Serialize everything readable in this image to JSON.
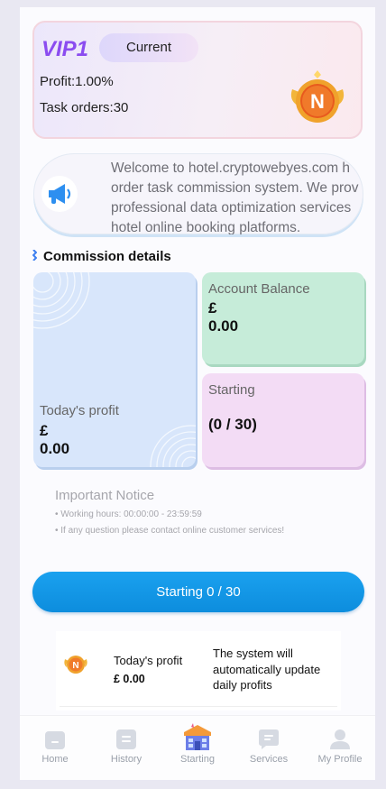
{
  "vip": {
    "level": "VIP1",
    "current_label": "Current",
    "profit": "Profit:1.00%",
    "task_orders": "Task orders:30"
  },
  "announcement": {
    "text": "Welcome to hotel.cryptowebyes.com h order task commission system. We prov professional data optimization services hotel online booking platforms."
  },
  "commission": {
    "title": "Commission details",
    "today_profit_label": "Today's profit",
    "today_profit_currency": "£",
    "today_profit_value": "0.00",
    "balance_label": "Account Balance",
    "balance_currency": "£",
    "balance_value": "0.00",
    "starting_label": "Starting",
    "starting_value": "(0 / 30)"
  },
  "notice": {
    "title": "Important Notice",
    "lines": [
      "• Working hours: 00:00:00 - 23:59:59",
      "• If any question please contact online customer services!"
    ]
  },
  "start_button": {
    "label": "Starting 0 / 30"
  },
  "daily": {
    "label": "Today's profit",
    "value": "£ 0.00",
    "note": "The system will automatically update daily profits"
  },
  "tabs": [
    {
      "label": "Home",
      "icon": "home-icon"
    },
    {
      "label": "History",
      "icon": "history-icon"
    },
    {
      "label": "Starting",
      "icon": "starting-icon"
    },
    {
      "label": "Services",
      "icon": "services-icon"
    },
    {
      "label": "My Profile",
      "icon": "profile-icon"
    }
  ],
  "colors": {
    "vip_text": "#8b4cf0",
    "accent_button": "#1aa1ef",
    "today_card": "#d8e6fb",
    "balance_card": "#c6ecd9",
    "starting_card": "#f3dcf5"
  }
}
